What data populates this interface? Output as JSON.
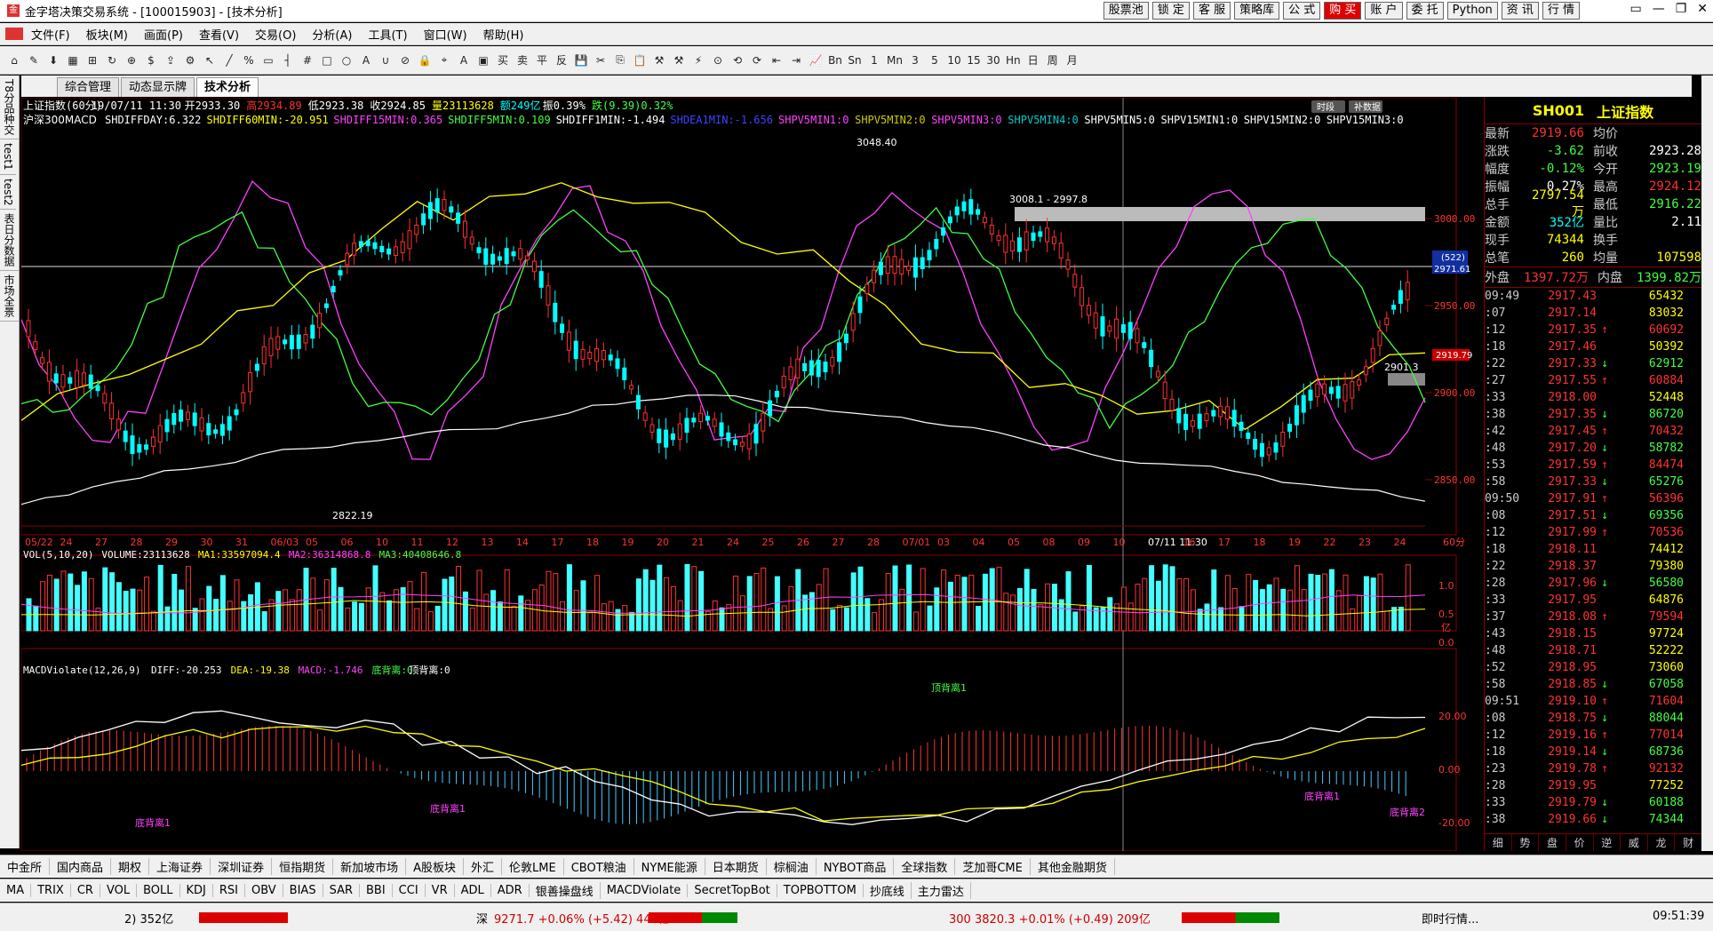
{
  "window": {
    "title": "金字塔决策交易系统 - [100015903] - [技术分析]",
    "buttons": [
      "股票池",
      "锁 定",
      "客 服",
      "策略库",
      "公 式",
      "购 买",
      "账 户",
      "委 托",
      "Python",
      "资 讯",
      "行 情"
    ],
    "controls": [
      "▭",
      "—",
      "❐",
      "✕"
    ]
  },
  "menu": [
    "文件(F)",
    "板块(M)",
    "画面(P)",
    "查看(V)",
    "交易(O)",
    "分析(A)",
    "工具(T)",
    "窗口(W)",
    "帮助(H)"
  ],
  "toolbar": {
    "periods": [
      "1",
      "Mn",
      "3",
      "5",
      "10",
      "15",
      "30",
      "Hn",
      "日",
      "周",
      "月"
    ]
  },
  "left_tabs": [
    "T8分品种交",
    "test1",
    "test2",
    "表日分数据",
    "市场全景"
  ],
  "tabs": [
    "综合管理",
    "动态显示牌",
    "技术分析"
  ],
  "kline_info": {
    "symbol": "上证指数(60分)",
    "date": "19/07/11 11:30",
    "open": "开2933.30",
    "high": "高2934.89",
    "low": "低2923.38",
    "close": "收2924.85",
    "volume": "量23113628",
    "amount": "额249亿",
    "amplitude": "振0.39%",
    "change": "跌(9.39)0.32%"
  },
  "indicator_line": {
    "name": "沪深300MACD",
    "items": [
      {
        "label": "SHDIFFDAY:6.322",
        "color": "#ffffff"
      },
      {
        "label": "SHDIFF60MIN:-20.951",
        "color": "#ffff00"
      },
      {
        "label": "SHDIFF15MIN:0.365",
        "color": "#ff40ff"
      },
      {
        "label": "SHDIFF5MIN:0.109",
        "color": "#40ff40"
      },
      {
        "label": "SHDIFF1MIN:-1.494",
        "color": "#ffffff"
      },
      {
        "label": "SHDEA1MIN:-1.656",
        "color": "#4040ff"
      },
      {
        "label": "SHPV5MIN1:0",
        "color": "#ff40ff"
      },
      {
        "label": "SHPV5MIN2:0",
        "color": "#cccc00"
      },
      {
        "label": "SHPV5MIN3:0",
        "color": "#ff40ff"
      },
      {
        "label": "SHPV5MIN4:0",
        "color": "#00cccc"
      },
      {
        "label": "SHPV5MIN5:0",
        "color": "#ffffff"
      },
      {
        "label": "SHPV15MIN1:0",
        "color": "#ffffff"
      },
      {
        "label": "SHPV15MIN2:0",
        "color": "#ffffff"
      },
      {
        "label": "SHPV15MIN3:0",
        "color": "#ffffff"
      }
    ],
    "buttons": [
      "时段",
      "补数据"
    ]
  },
  "price_axis": [
    "3000.00",
    "2950.00",
    "2900.00",
    "2850.00"
  ],
  "price_marks": {
    "current": "2919.79",
    "cross_tag": "(522)",
    "cross_price": "2971.61",
    "high_label": "3048.40",
    "low_label": "2822.19",
    "range_label": "3008.1 - 2997.8",
    "mid_label": "2901.3"
  },
  "date_axis": [
    "05/22",
    "24",
    "27",
    "28",
    "29",
    "30",
    "31",
    "06/03",
    "05",
    "06",
    "10",
    "11",
    "12",
    "13",
    "14",
    "17",
    "18",
    "19",
    "20",
    "21",
    "24",
    "25",
    "26",
    "27",
    "28",
    "07/01",
    "03",
    "04",
    "05",
    "08",
    "09",
    "10",
    "07/11 11:30",
    "16",
    "17",
    "18",
    "19",
    "22",
    "23",
    "24"
  ],
  "period_label": "60分",
  "vol_info": {
    "title": "VOL(5,10,20)",
    "volume": "VOLUME:23113628",
    "ma1": "MA1:33597094.4",
    "ma2": "MA2:36314868.8",
    "ma3": "MA3:40408646.8"
  },
  "vol_axis": [
    "1.0",
    "0.5",
    "0.0"
  ],
  "vol_unit": "亿",
  "macd_info": {
    "title": "MACDViolate(12,26,9)",
    "diff": "DIFF:-20.253",
    "dea": "DEA:-19.38",
    "macd": "MACD:-1.746",
    "bottom": "底背离:0",
    "top": "顶背离:0"
  },
  "macd_axis": [
    "20.00",
    "0.00",
    "-20.00"
  ],
  "macd_labels": [
    "底背离1",
    "底背离1",
    "顶背离1",
    "底背离1",
    "底背离2"
  ],
  "quote": {
    "code": "SH001",
    "name": "上证指数",
    "rows": [
      {
        "k1": "最新",
        "v1": "2919.66",
        "c1": "#ff3030",
        "k2": "均价",
        "v2": "",
        "c2": "#ffffff"
      },
      {
        "k1": "涨跌",
        "v1": "-3.62",
        "c1": "#40ff40",
        "k2": "前收",
        "v2": "2923.28",
        "c2": "#ffffff"
      },
      {
        "k1": "幅度",
        "v1": "-0.12%",
        "c1": "#40ff40",
        "k2": "今开",
        "v2": "2923.19",
        "c2": "#40ff40"
      },
      {
        "k1": "振幅",
        "v1": "0.27%",
        "c1": "#ffffff",
        "k2": "最高",
        "v2": "2924.12",
        "c2": "#ff3030"
      },
      {
        "k1": "总手",
        "v1": "2797.54万",
        "c1": "#ffff00",
        "k2": "最低",
        "v2": "2916.22",
        "c2": "#40ff40"
      },
      {
        "k1": "金额",
        "v1": "352亿",
        "c1": "#00ffff",
        "k2": "量比",
        "v2": "2.11",
        "c2": "#ffffff"
      },
      {
        "k1": "现手",
        "v1": "74344",
        "c1": "#ffff00",
        "k2": "换手",
        "v2": "",
        "c2": "#ffffff"
      },
      {
        "k1": "总笔",
        "v1": "260",
        "c1": "#ffff00",
        "k2": "均量",
        "v2": "107598",
        "c2": "#ffff00"
      }
    ],
    "outer": {
      "k1": "外盘",
      "v1": "1397.72万",
      "k2": "内盘",
      "v2": "1399.82万"
    }
  },
  "ticks": [
    {
      "t": "09:49",
      "p": "2917.43",
      "a": "",
      "v": "65432"
    },
    {
      "t": ":07",
      "p": "2917.14",
      "a": "",
      "v": "83032"
    },
    {
      "t": ":12",
      "p": "2917.35",
      "a": "↑",
      "v": "60692"
    },
    {
      "t": ":18",
      "p": "2917.46",
      "a": "",
      "v": "50392"
    },
    {
      "t": ":22",
      "p": "2917.33",
      "a": "↓",
      "v": "62912"
    },
    {
      "t": ":27",
      "p": "2917.55",
      "a": "↑",
      "v": "60884"
    },
    {
      "t": ":33",
      "p": "2918.00",
      "a": "",
      "v": "52448"
    },
    {
      "t": ":38",
      "p": "2917.35",
      "a": "↓",
      "v": "86720"
    },
    {
      "t": ":42",
      "p": "2917.45",
      "a": "↑",
      "v": "70432"
    },
    {
      "t": ":48",
      "p": "2917.20",
      "a": "↓",
      "v": "58782"
    },
    {
      "t": ":53",
      "p": "2917.59",
      "a": "↑",
      "v": "84474"
    },
    {
      "t": ":58",
      "p": "2917.33",
      "a": "↓",
      "v": "65276"
    },
    {
      "t": "09:50",
      "p": "2917.91",
      "a": "↑",
      "v": "56396"
    },
    {
      "t": ":08",
      "p": "2917.51",
      "a": "↓",
      "v": "69356"
    },
    {
      "t": ":12",
      "p": "2917.99",
      "a": "↑",
      "v": "70536"
    },
    {
      "t": ":18",
      "p": "2918.11",
      "a": "",
      "v": "74412"
    },
    {
      "t": ":22",
      "p": "2918.37",
      "a": "",
      "v": "79380"
    },
    {
      "t": ":28",
      "p": "2917.96",
      "a": "↓",
      "v": "56580"
    },
    {
      "t": ":33",
      "p": "2917.95",
      "a": "",
      "v": "64876"
    },
    {
      "t": ":37",
      "p": "2918.08",
      "a": "↑",
      "v": "79594"
    },
    {
      "t": ":43",
      "p": "2918.15",
      "a": "",
      "v": "97724"
    },
    {
      "t": ":48",
      "p": "2918.71",
      "a": "",
      "v": "52222"
    },
    {
      "t": ":52",
      "p": "2918.95",
      "a": "",
      "v": "73060"
    },
    {
      "t": ":58",
      "p": "2918.85",
      "a": "↓",
      "v": "67058"
    },
    {
      "t": "09:51",
      "p": "2919.10",
      "a": "↑",
      "v": "71604"
    },
    {
      "t": ":08",
      "p": "2918.75",
      "a": "↓",
      "v": "88044"
    },
    {
      "t": ":12",
      "p": "2919.16",
      "a": "↑",
      "v": "77014"
    },
    {
      "t": ":18",
      "p": "2919.14",
      "a": "↓",
      "v": "68736"
    },
    {
      "t": ":23",
      "p": "2919.78",
      "a": "↑",
      "v": "92132"
    },
    {
      "t": ":28",
      "p": "2919.95",
      "a": "",
      "v": "77252"
    },
    {
      "t": ":33",
      "p": "2919.79",
      "a": "↓",
      "v": "60188"
    },
    {
      "t": ":38",
      "p": "2919.66",
      "a": "↓",
      "v": "74344"
    }
  ],
  "right_tabs": [
    "细",
    "势",
    "盘",
    "价",
    "逆",
    "威",
    "龙",
    "财"
  ],
  "market_tabs": [
    "中金所",
    "国内商品",
    "期权",
    "上海证券",
    "深圳证券",
    "恒指期货",
    "新加坡市场",
    "A股板块",
    "外汇",
    "伦敦LME",
    "CBOT粮油",
    "NYME能源",
    "日本期货",
    "棕榈油",
    "NYBOT商品",
    "全球指数",
    "芝加哥CME",
    "其他金融期货"
  ],
  "indicator_tabs": [
    "MA",
    "TRIX",
    "CR",
    "VOL",
    "BOLL",
    "KDJ",
    "RSI",
    "OBV",
    "BIAS",
    "SAR",
    "BBI",
    "CCI",
    "VR",
    "ADL",
    "ADR",
    "银善操盘线",
    "MACDViolate",
    "SecretTopBot",
    "TOPBOTTOM",
    "抄底线",
    "主力雷达"
  ],
  "status": {
    "sh_amount": "2) 352亿",
    "sz_label": "深",
    "sz": "9271.7 +0.06% (+5.42) 442亿",
    "hs300": "300 3820.3 +0.01% (+0.49) 209亿",
    "info": "即时行情...",
    "time": "09:51:39"
  }
}
